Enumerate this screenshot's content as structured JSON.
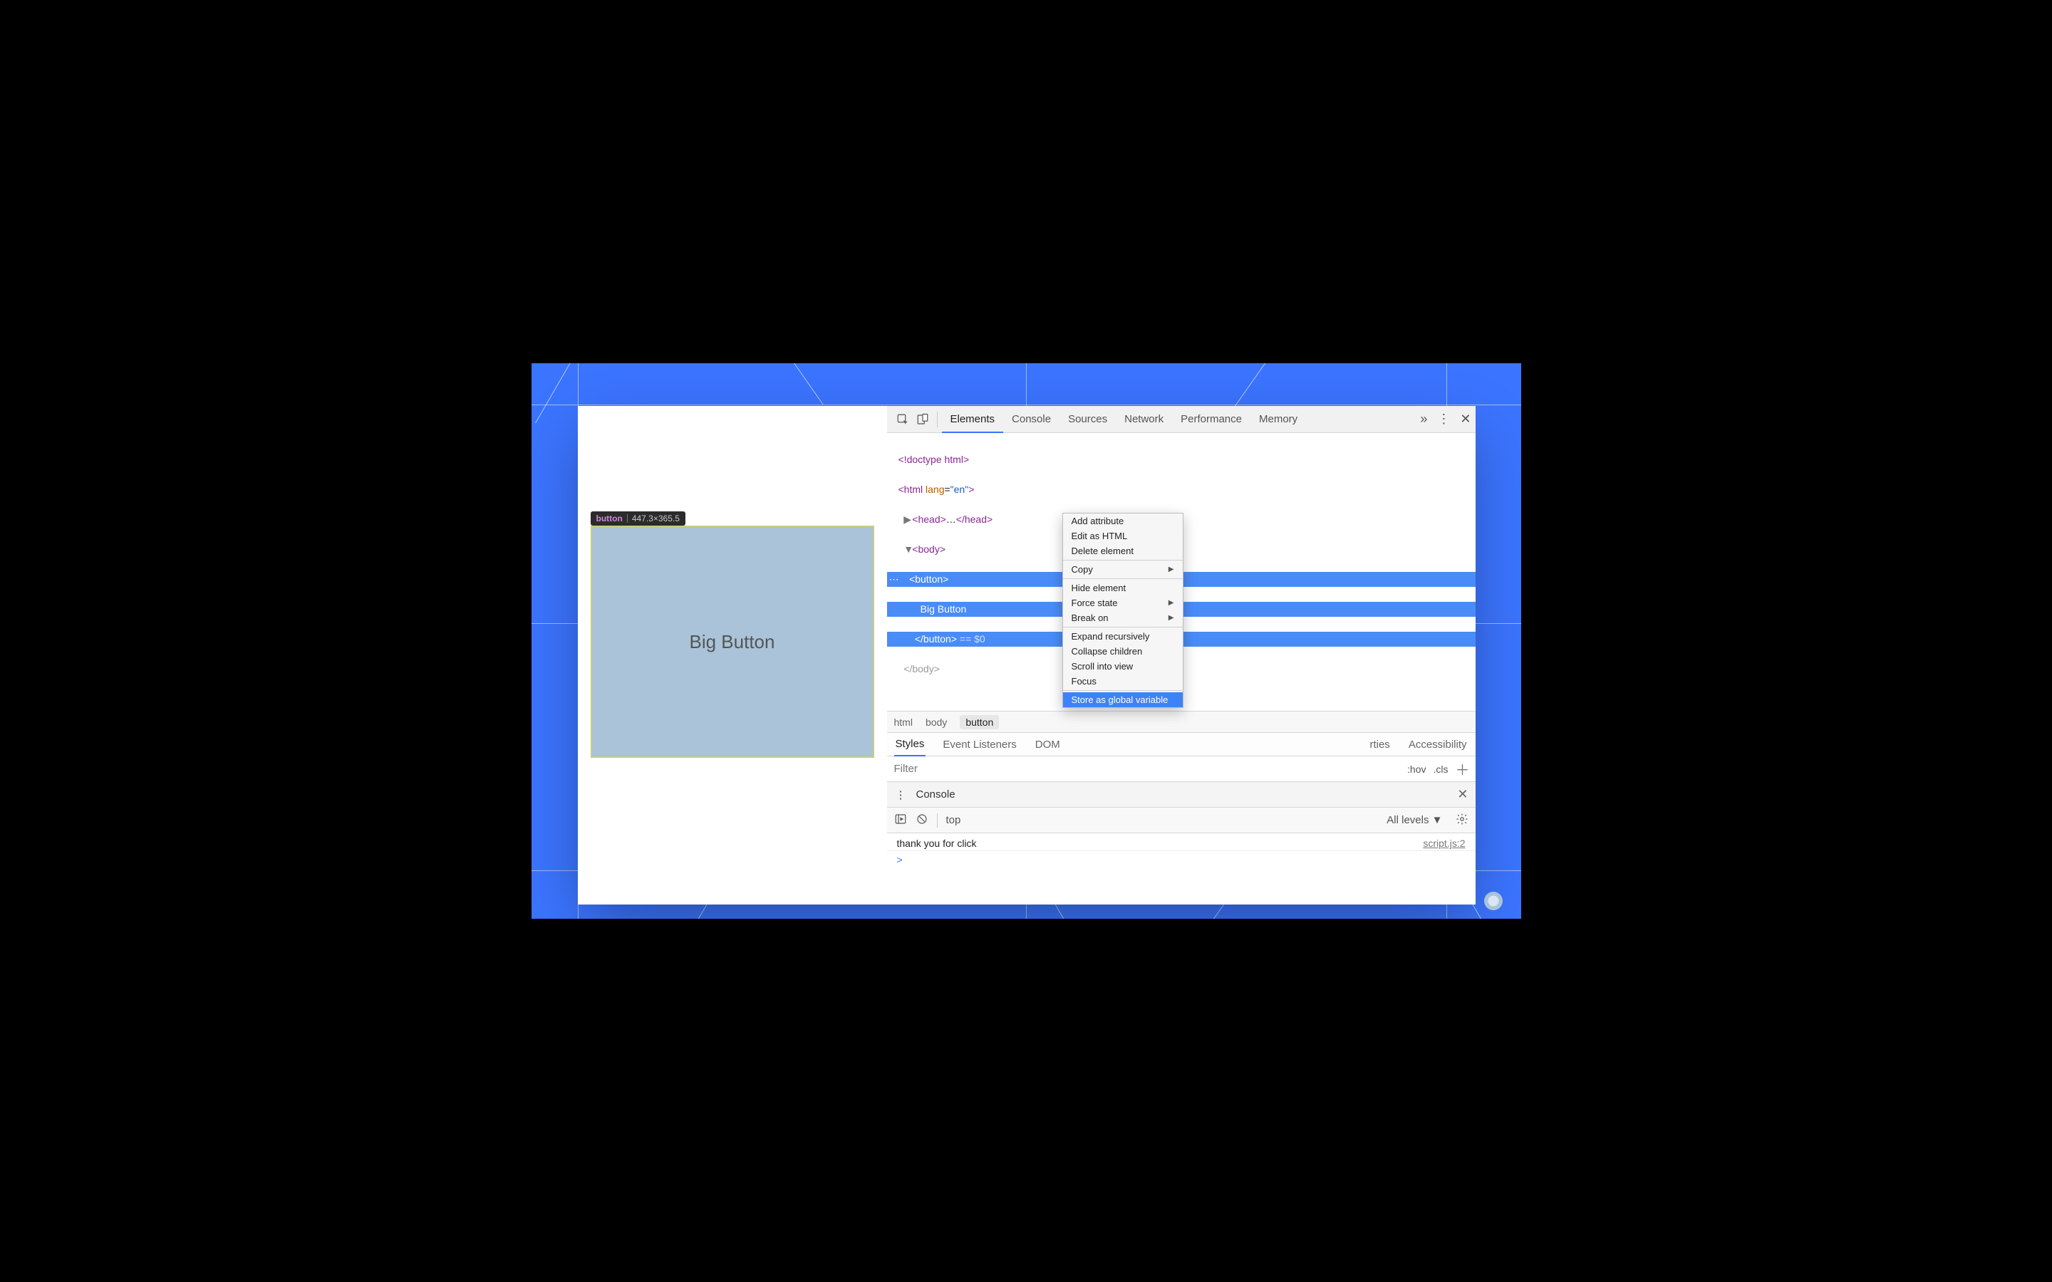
{
  "inspect_tooltip": {
    "tag": "button",
    "dims": "447.3×365.5"
  },
  "page": {
    "big_button_label": "Big Button"
  },
  "devtools": {
    "tabs": [
      "Elements",
      "Console",
      "Sources",
      "Network",
      "Performance",
      "Memory"
    ],
    "active_tab": "Elements",
    "dom": {
      "l1": "<!doctype html>",
      "l2_open": "<html ",
      "l2_attr": "lang",
      "l2_val": "\"en\"",
      "l2_close": ">",
      "l3_open": "<head>",
      "l3_ell": "…",
      "l3_close": "</head>",
      "l4": "<body>",
      "sel_open": "<button>",
      "sel_text": "Big Button",
      "sel_close": "</button>",
      "sel_hint": " == $0"
    },
    "breadcrumbs": [
      "html",
      "body",
      "button"
    ],
    "subtabs": [
      "Styles",
      "Event Listeners",
      "DOM Breakpoints",
      "Properties",
      "Accessibility"
    ],
    "subtab_dom_short": "DOM",
    "subtab_props_short": "rties",
    "filter_placeholder": "Filter",
    "filter_right": {
      "hov": ":hov",
      "cls": ".cls"
    },
    "console_drawer": {
      "title": "Console",
      "context": "top",
      "levels": "All levels ▼",
      "log_text": "thank you for click",
      "log_src": "script.js:2",
      "prompt": ">"
    }
  },
  "context_menu": {
    "items": [
      {
        "label": "Add attribute"
      },
      {
        "label": "Edit as HTML"
      },
      {
        "label": "Delete element"
      },
      {
        "divider": true
      },
      {
        "label": "Copy",
        "submenu": true
      },
      {
        "divider": true
      },
      {
        "label": "Hide element"
      },
      {
        "label": "Force state",
        "submenu": true
      },
      {
        "label": "Break on",
        "submenu": true
      },
      {
        "divider": true
      },
      {
        "label": "Expand recursively"
      },
      {
        "label": "Collapse children"
      },
      {
        "label": "Scroll into view"
      },
      {
        "label": "Focus"
      },
      {
        "divider": true
      },
      {
        "label": "Store as global variable",
        "highlight": true
      }
    ]
  }
}
